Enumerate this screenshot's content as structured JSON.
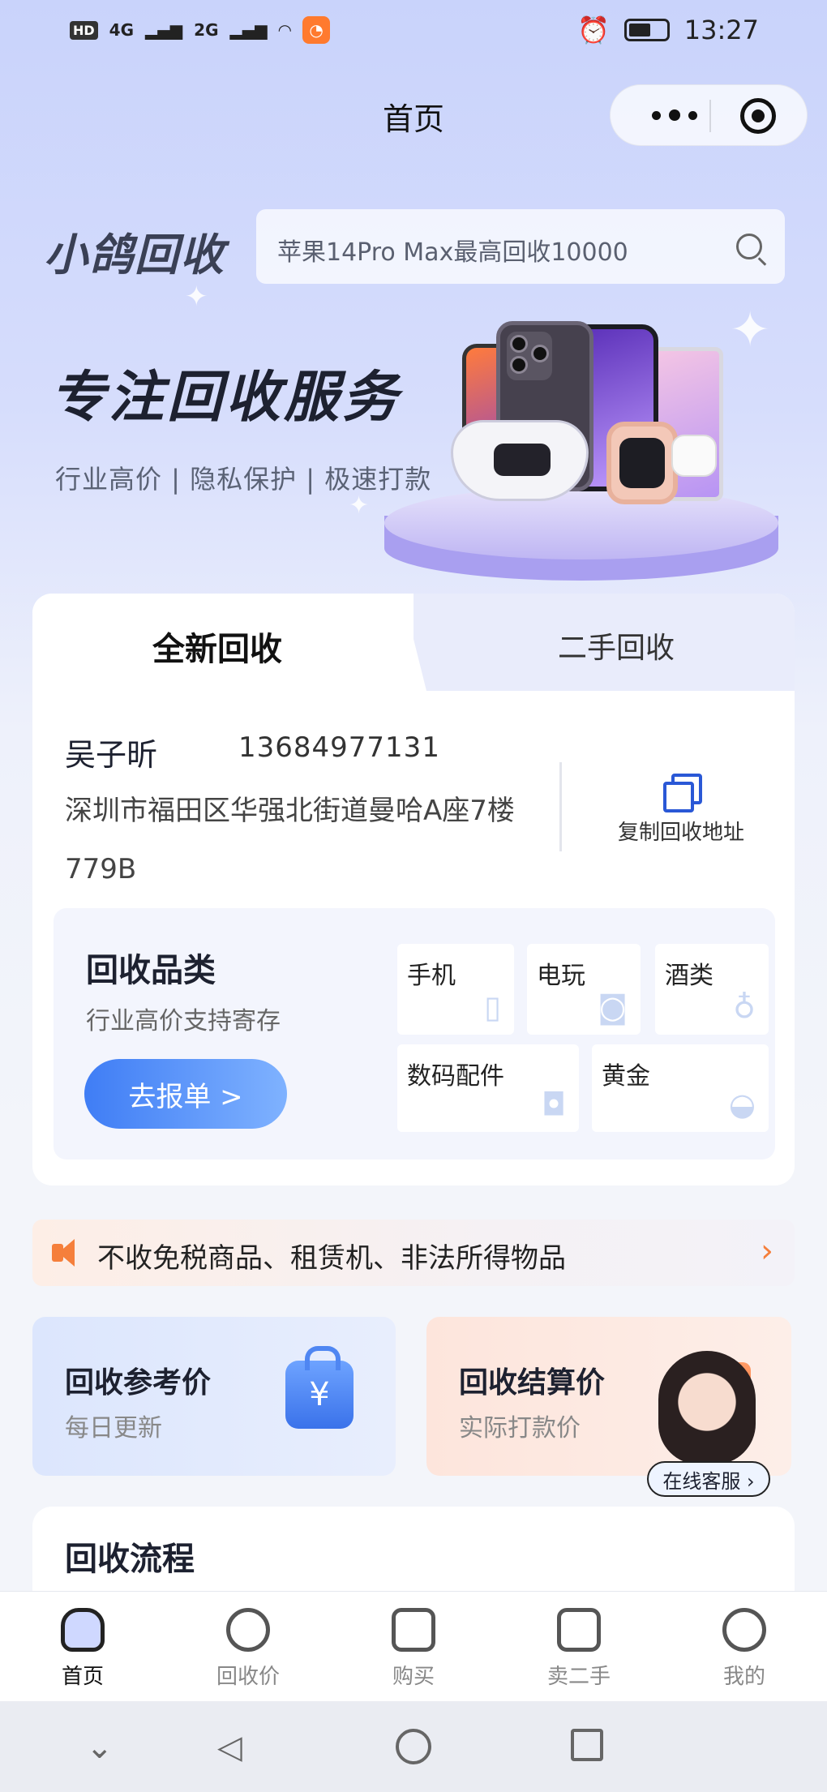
{
  "status_bar": {
    "network_1": "4G",
    "network_2": "2G",
    "time": "13:27"
  },
  "header": {
    "title": "首页"
  },
  "brand": {
    "name": "小鸽回收",
    "search_placeholder": "苹果14Pro Max最高回收10000"
  },
  "banner": {
    "title": "专注回收服务",
    "subtitle": "行业高价 | 隐私保护 | 极速打款"
  },
  "tabs": {
    "active": "全新回收",
    "inactive": "二手回收"
  },
  "address": {
    "name": "吴子昕",
    "phone": "13684977131",
    "line": "深圳市福田区华强北街道曼哈A座7楼779B",
    "copy_label": "复制回收地址"
  },
  "categories": {
    "title": "回收品类",
    "subtitle": "行业高价支持寄存",
    "button": "去报单 >",
    "items": [
      {
        "label": "手机",
        "icon": "phone-icon"
      },
      {
        "label": "电玩",
        "icon": "gamepad-icon"
      },
      {
        "label": "酒类",
        "icon": "bottle-icon"
      },
      {
        "label": "数码配件",
        "icon": "camera-icon"
      },
      {
        "label": "黄金",
        "icon": "gold-ingot-icon"
      }
    ]
  },
  "notice": {
    "text": "不收免税商品、租赁机、非法所得物品"
  },
  "price_cards": {
    "reference": {
      "title": "回收参考价",
      "subtitle": "每日更新",
      "icon_glyph": "¥"
    },
    "settlement": {
      "title": "回收结算价",
      "subtitle": "实际打款价",
      "icon_glyph": "¥"
    }
  },
  "support": {
    "label": "在线客服 ›"
  },
  "flow": {
    "title": "回收流程"
  },
  "bottom_tabs": [
    {
      "label": "首页",
      "active": true
    },
    {
      "label": "回收价",
      "active": false
    },
    {
      "label": "购买",
      "active": false
    },
    {
      "label": "卖二手",
      "active": false
    },
    {
      "label": "我的",
      "active": false
    }
  ],
  "colors": {
    "accent_blue": "#3f7df5",
    "accent_orange": "#f57f3b"
  }
}
